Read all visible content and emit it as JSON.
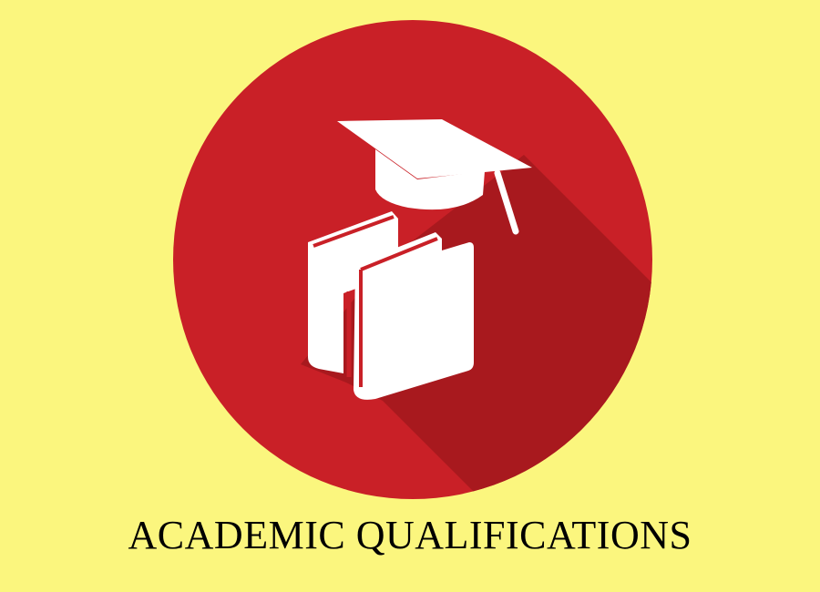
{
  "caption": "ACADEMIC QUALIFICATIONS",
  "colors": {
    "background": "#fbf67e",
    "circle": "#c92027",
    "long_shadow": "#a8191e",
    "icon": "#ffffff",
    "text": "#000000"
  },
  "icons": [
    "graduation-cap-icon",
    "books-icon"
  ]
}
